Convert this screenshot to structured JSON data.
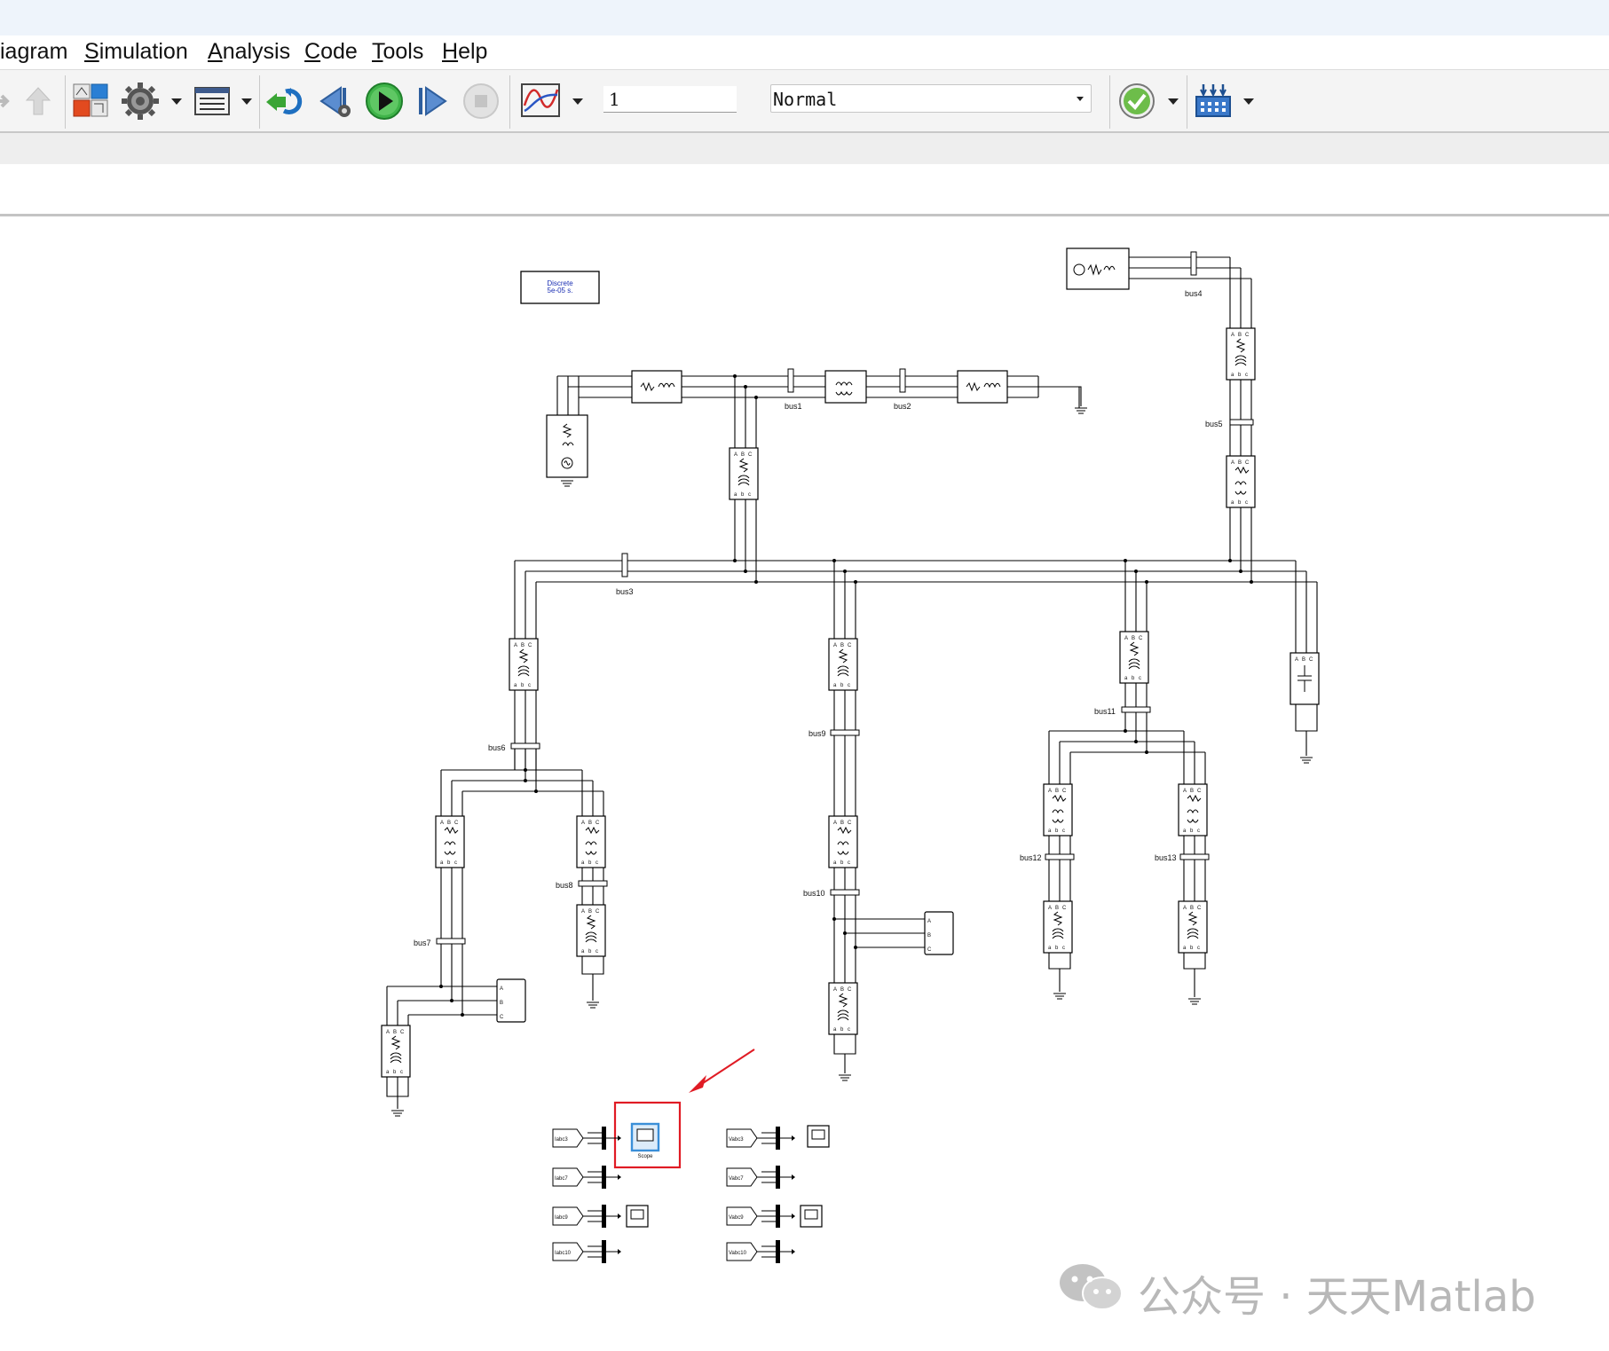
{
  "menu": {
    "items": [
      {
        "label": "iagram",
        "ul": ""
      },
      {
        "label": "Simulation",
        "ul": "S"
      },
      {
        "label": "Analysis",
        "ul": "A"
      },
      {
        "label": "Code",
        "ul": "C"
      },
      {
        "label": "Tools",
        "ul": "T"
      },
      {
        "label": "Help",
        "ul": "H"
      }
    ]
  },
  "toolbar": {
    "stop_time": "1",
    "sim_mode": "Normal",
    "icons": [
      "forward-icon",
      "up-folder-icon",
      "library-browser-icon",
      "model-settings-gear-icon",
      "model-explorer-icon",
      "update-diagram-icon",
      "step-back-icon",
      "run-icon",
      "step-forward-icon",
      "stop-icon",
      "data-inspector-icon",
      "model-advisor-check-icon",
      "hardware-board-icon"
    ]
  },
  "diagram": {
    "powergui": {
      "line1": "Discrete",
      "line2": "5e-05 s."
    },
    "bus_labels": [
      "bus1",
      "bus2",
      "bus3",
      "bus4",
      "bus5",
      "bus6",
      "bus7",
      "bus8",
      "bus9",
      "bus10",
      "bus11",
      "bus12",
      "bus13"
    ],
    "from_tags": [
      "Iabc3",
      "Iabc7",
      "Iabc9",
      "Iabc10",
      "Vabc3",
      "Vabc7",
      "Vabc9",
      "Vabc10"
    ],
    "scope_label": "Scope",
    "colors": {
      "wire": "#000000",
      "highlight": "#e01b24",
      "selected": "#3a8fd8"
    }
  },
  "watermark": {
    "text": "公众号 · 天天Matlab"
  }
}
